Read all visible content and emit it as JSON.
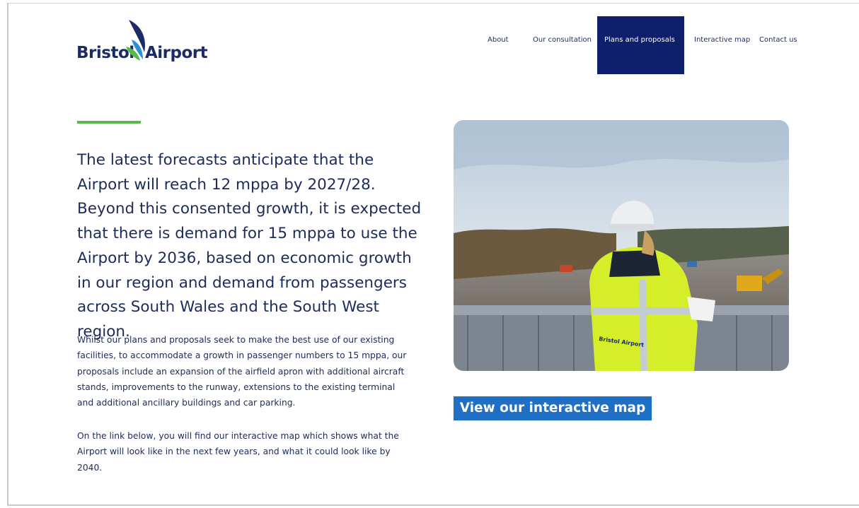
{
  "brand": {
    "name_part1": "Bristol",
    "name_part2": "Airport"
  },
  "nav": {
    "items": [
      {
        "label": "About",
        "active": false
      },
      {
        "label": "Our consultation",
        "active": false
      },
      {
        "label": "Plans and proposals",
        "active": true
      },
      {
        "label": "Interactive map",
        "active": false
      },
      {
        "label": "Contact us",
        "active": false
      }
    ]
  },
  "content": {
    "lead": "The latest forecasts anticipate that the Airport will reach 12 mppa by 2027/28. Beyond this consented growth, it is expected that there is demand for 15 mppa to use the Airport by 2036, based on economic growth in our region and demand from passengers across South Wales and the South West region.",
    "paragraph1": "Whilst our plans and proposals seek to make the best use of our existing facilities, to accommodate a growth in passenger numbers to 15 mppa, our proposals include an expansion of the airfield apron with additional aircraft stands, improvements to the runway, extensions to the existing terminal and additional ancillary buildings and car parking.",
    "paragraph2": "On the link below, you will find our interactive map which shows what the Airport will look like in the next few years, and what it could look like by 2040."
  },
  "photo": {
    "jacket_text": "Bristol Airport"
  },
  "cta": {
    "label": "View our interactive map"
  },
  "colors": {
    "navy": "#1c2b59",
    "nav_active_bg": "#0e1f6b",
    "accent_green": "#56b948",
    "cta_blue": "#1f6fc5",
    "hi_vis_yellow": "#d4ee2a"
  }
}
